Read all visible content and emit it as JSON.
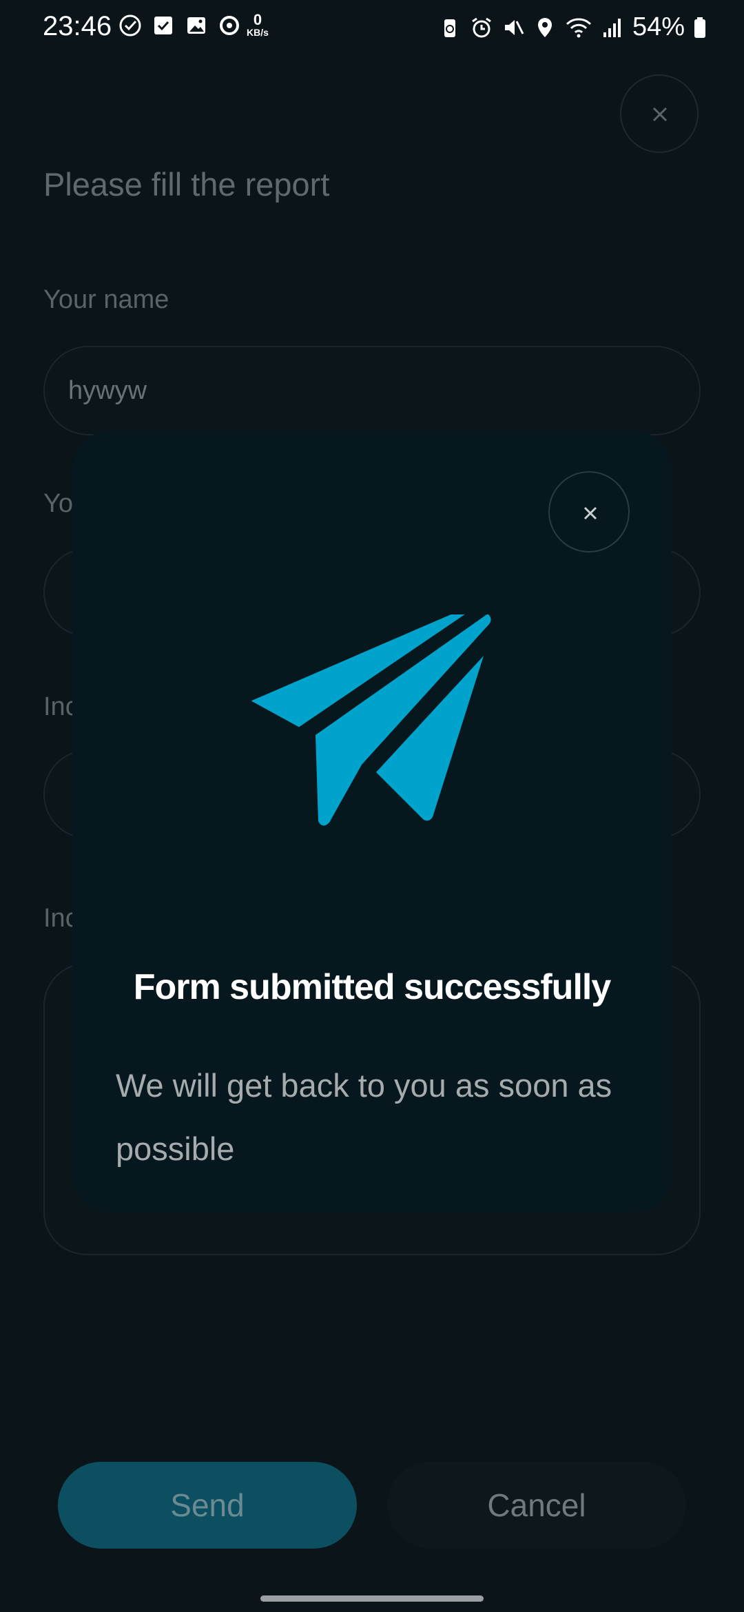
{
  "status_bar": {
    "time": "23:46",
    "net_speed_value": "0",
    "net_speed_unit": "KB/s",
    "battery": "54%",
    "left_icons": [
      "check-circle-icon",
      "checkbox-icon",
      "image-icon",
      "sync-icon"
    ],
    "right_icons": [
      "battery-saver-icon",
      "alarm-icon",
      "mute-icon",
      "location-icon",
      "wifi-icon",
      "signal-icon"
    ]
  },
  "form": {
    "title": "Please fill the report",
    "name_label": "Your name",
    "name_value": "hywyw",
    "field2_label_partial": "Yo",
    "field3_label_partial": "Inc",
    "field4_label_partial": "Inc",
    "send_label": "Send",
    "cancel_label": "Cancel"
  },
  "modal": {
    "title": "Form submitted successfully",
    "description": "We will get back to you as soon as possible",
    "icon": "paper-plane-icon",
    "accent_color": "#00a3cc"
  }
}
